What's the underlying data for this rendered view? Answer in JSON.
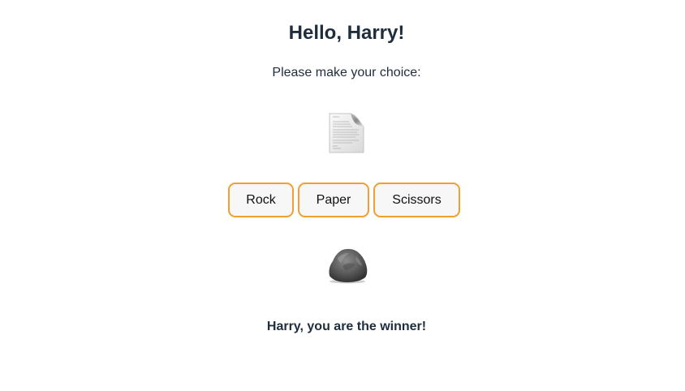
{
  "header": {
    "greeting": "Hello, Harry!"
  },
  "prompt": {
    "text": "Please make your choice:"
  },
  "player_choice": {
    "icon": "paper-document-icon"
  },
  "choices": [
    {
      "label": "Rock"
    },
    {
      "label": "Paper"
    },
    {
      "label": "Scissors"
    }
  ],
  "computer_choice": {
    "icon": "rock-icon"
  },
  "result": {
    "text": "Harry, you are the winner!"
  },
  "colors": {
    "accent_border": "#f0a030",
    "text": "#1f2d3d",
    "button_bg": "#f7f7f7"
  }
}
